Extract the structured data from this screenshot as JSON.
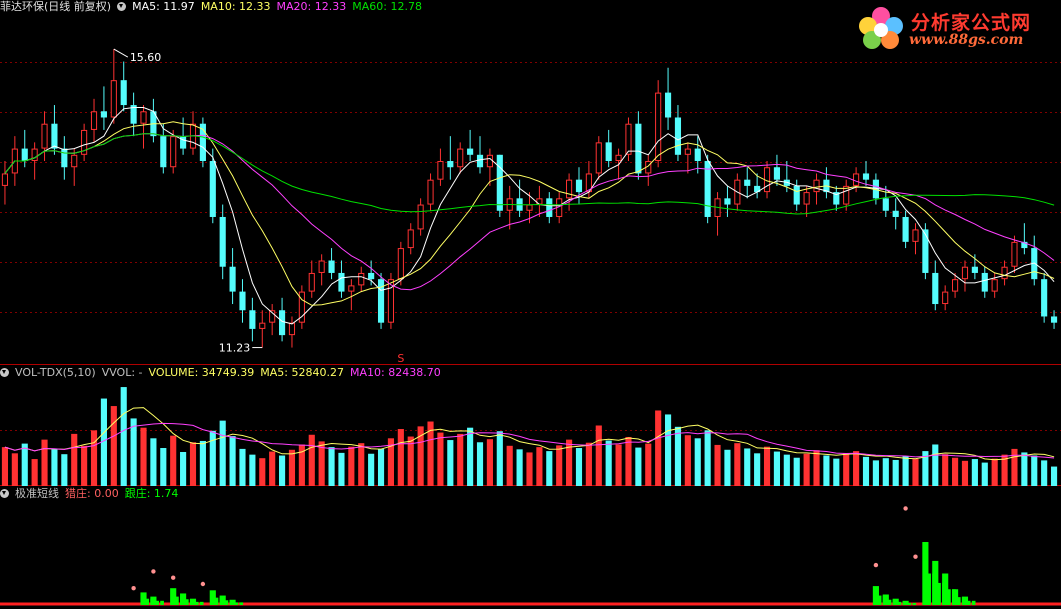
{
  "price_header": {
    "title": "菲达环保(日线 前复权)",
    "ma5": "MA5: 11.97",
    "ma10": "MA10: 12.33",
    "ma20": "MA20: 12.33",
    "ma60": "MA60: 12.78"
  },
  "vol_header": {
    "title": "VOL-TDX(5,10)",
    "vvol": "VVOL: -",
    "volume": "VOLUME: 34749.39",
    "ma5": "MA5: 52840.27",
    "ma10": "MA10: 82438.70"
  },
  "ind_header": {
    "title": "极准短线",
    "lie": "猎庄: 0.00",
    "gen": "跟庄: 1.74"
  },
  "logo": {
    "title": "分析家公式网",
    "url": "www.88gs.com"
  },
  "marker": "S",
  "colors": {
    "up": "#ff3232",
    "down": "#54fcfc",
    "ma5": "#ffffff",
    "ma10": "#ffff64",
    "ma20": "#ff40ff",
    "ma60": "#00e000",
    "grid": "#800000",
    "green_bar": "#00ff00",
    "red_band": "#ff2020",
    "dot": "#ff9090"
  },
  "chart_data": {
    "type": "candlestick",
    "high_label": "15.60",
    "low_label": "11.23",
    "price_ylim": [
      10.6,
      16.1
    ],
    "candles": [
      [
        13.4,
        13.8,
        13.1,
        13.6
      ],
      [
        13.6,
        14.2,
        13.4,
        14.0
      ],
      [
        14.0,
        14.3,
        13.7,
        13.8
      ],
      [
        13.8,
        14.1,
        13.5,
        14.0
      ],
      [
        14.0,
        14.6,
        13.8,
        14.4
      ],
      [
        14.4,
        14.7,
        13.9,
        14.0
      ],
      [
        14.0,
        14.2,
        13.5,
        13.7
      ],
      [
        13.7,
        14.0,
        13.4,
        13.9
      ],
      [
        13.9,
        14.4,
        13.8,
        14.3
      ],
      [
        14.3,
        14.8,
        14.1,
        14.6
      ],
      [
        14.6,
        15.0,
        14.3,
        14.5
      ],
      [
        14.5,
        15.6,
        14.4,
        15.1
      ],
      [
        15.1,
        15.4,
        14.6,
        14.7
      ],
      [
        14.7,
        14.9,
        14.2,
        14.4
      ],
      [
        14.4,
        14.7,
        14.0,
        14.6
      ],
      [
        14.6,
        14.8,
        14.1,
        14.2
      ],
      [
        14.2,
        14.4,
        13.6,
        13.7
      ],
      [
        13.7,
        14.3,
        13.6,
        14.2
      ],
      [
        14.2,
        14.5,
        13.9,
        14.0
      ],
      [
        14.0,
        14.6,
        13.9,
        14.4
      ],
      [
        14.4,
        14.5,
        13.7,
        13.8
      ],
      [
        13.8,
        14.0,
        12.8,
        12.9
      ],
      [
        12.9,
        13.1,
        11.9,
        12.1
      ],
      [
        12.1,
        12.4,
        11.5,
        11.7
      ],
      [
        11.7,
        11.9,
        11.2,
        11.4
      ],
      [
        11.4,
        11.6,
        10.9,
        11.1
      ],
      [
        11.1,
        11.4,
        10.8,
        11.2
      ],
      [
        11.2,
        11.5,
        11.0,
        11.4
      ],
      [
        11.4,
        11.6,
        10.9,
        11.0
      ],
      [
        11.0,
        11.3,
        10.8,
        11.2
      ],
      [
        11.2,
        11.8,
        11.1,
        11.7
      ],
      [
        11.7,
        12.2,
        11.6,
        12.0
      ],
      [
        12.0,
        12.3,
        11.8,
        12.2
      ],
      [
        12.2,
        12.4,
        11.9,
        12.0
      ],
      [
        12.0,
        12.2,
        11.6,
        11.7
      ],
      [
        11.7,
        11.9,
        11.4,
        11.8
      ],
      [
        11.8,
        12.1,
        11.7,
        12.0
      ],
      [
        12.0,
        12.2,
        11.8,
        11.9
      ],
      [
        11.9,
        12.0,
        11.1,
        11.2
      ],
      [
        11.2,
        12.0,
        11.1,
        11.9
      ],
      [
        11.9,
        12.5,
        11.8,
        12.4
      ],
      [
        12.4,
        12.8,
        12.3,
        12.7
      ],
      [
        12.7,
        13.2,
        12.6,
        13.1
      ],
      [
        13.1,
        13.6,
        13.0,
        13.5
      ],
      [
        13.5,
        14.0,
        13.4,
        13.8
      ],
      [
        13.8,
        14.2,
        13.5,
        13.7
      ],
      [
        13.7,
        14.1,
        13.6,
        14.0
      ],
      [
        14.0,
        14.3,
        13.8,
        13.9
      ],
      [
        13.9,
        14.2,
        13.6,
        13.7
      ],
      [
        13.7,
        14.0,
        13.4,
        13.9
      ],
      [
        13.9,
        13.9,
        12.9,
        13.0
      ],
      [
        13.0,
        13.4,
        12.7,
        13.2
      ],
      [
        13.2,
        13.5,
        12.9,
        13.0
      ],
      [
        13.0,
        13.3,
        12.8,
        13.1
      ],
      [
        13.1,
        13.4,
        12.9,
        13.2
      ],
      [
        13.2,
        13.3,
        12.8,
        12.9
      ],
      [
        12.9,
        13.3,
        12.8,
        13.2
      ],
      [
        13.2,
        13.6,
        13.0,
        13.5
      ],
      [
        13.5,
        13.7,
        13.1,
        13.3
      ],
      [
        13.3,
        13.8,
        13.2,
        13.6
      ],
      [
        13.6,
        14.2,
        13.5,
        14.1
      ],
      [
        14.1,
        14.3,
        13.7,
        13.8
      ],
      [
        13.8,
        14.0,
        13.5,
        13.9
      ],
      [
        13.9,
        14.5,
        13.8,
        14.4
      ],
      [
        14.4,
        14.6,
        13.5,
        13.6
      ],
      [
        13.6,
        13.9,
        13.4,
        13.8
      ],
      [
        13.8,
        15.1,
        13.7,
        14.9
      ],
      [
        14.9,
        15.3,
        14.3,
        14.5
      ],
      [
        14.5,
        14.7,
        13.8,
        13.9
      ],
      [
        13.9,
        14.1,
        13.6,
        14.0
      ],
      [
        14.0,
        14.2,
        13.6,
        13.8
      ],
      [
        13.8,
        13.9,
        12.8,
        12.9
      ],
      [
        12.9,
        13.3,
        12.6,
        13.2
      ],
      [
        13.2,
        13.4,
        12.9,
        13.1
      ],
      [
        13.1,
        13.6,
        13.0,
        13.5
      ],
      [
        13.5,
        13.7,
        13.2,
        13.4
      ],
      [
        13.4,
        13.6,
        13.2,
        13.3
      ],
      [
        13.3,
        13.8,
        13.2,
        13.7
      ],
      [
        13.7,
        13.9,
        13.4,
        13.5
      ],
      [
        13.5,
        13.8,
        13.3,
        13.4
      ],
      [
        13.4,
        13.5,
        13.0,
        13.1
      ],
      [
        13.1,
        13.4,
        12.9,
        13.3
      ],
      [
        13.3,
        13.6,
        13.1,
        13.5
      ],
      [
        13.5,
        13.7,
        13.2,
        13.3
      ],
      [
        13.3,
        13.4,
        13.0,
        13.1
      ],
      [
        13.1,
        13.5,
        13.0,
        13.4
      ],
      [
        13.4,
        13.7,
        13.3,
        13.6
      ],
      [
        13.6,
        13.8,
        13.4,
        13.5
      ],
      [
        13.5,
        13.6,
        13.1,
        13.2
      ],
      [
        13.2,
        13.4,
        12.9,
        13.0
      ],
      [
        13.0,
        13.2,
        12.7,
        12.9
      ],
      [
        12.9,
        13.0,
        12.4,
        12.5
      ],
      [
        12.5,
        12.8,
        12.3,
        12.7
      ],
      [
        12.7,
        12.8,
        11.9,
        12.0
      ],
      [
        12.0,
        12.2,
        11.4,
        11.5
      ],
      [
        11.5,
        11.8,
        11.4,
        11.7
      ],
      [
        11.7,
        12.0,
        11.6,
        11.9
      ],
      [
        11.9,
        12.2,
        11.7,
        12.1
      ],
      [
        12.1,
        12.3,
        11.9,
        12.0
      ],
      [
        12.0,
        12.1,
        11.6,
        11.7
      ],
      [
        11.7,
        12.0,
        11.6,
        11.9
      ],
      [
        11.9,
        12.2,
        11.8,
        12.1
      ],
      [
        12.1,
        12.6,
        12.0,
        12.5
      ],
      [
        12.5,
        12.8,
        12.3,
        12.4
      ],
      [
        12.4,
        12.6,
        11.8,
        11.9
      ],
      [
        11.9,
        12.0,
        11.2,
        11.3
      ],
      [
        11.3,
        11.4,
        11.1,
        11.2
      ]
    ],
    "volumes": [
      8.8,
      7.4,
      9.6,
      6.1,
      10.5,
      8.3,
      7.2,
      11.8,
      9.1,
      12.6,
      19.8,
      18.1,
      22.4,
      15.3,
      13.2,
      10.8,
      8.6,
      11.4,
      7.7,
      9.9,
      10.2,
      12.5,
      14.8,
      11.3,
      8.4,
      7.1,
      6.3,
      7.8,
      6.9,
      8.2,
      9.4,
      11.6,
      10.1,
      8.8,
      7.5,
      8.9,
      9.7,
      7.3,
      8.4,
      10.8,
      12.9,
      11.2,
      13.5,
      14.6,
      12.1,
      10.4,
      11.8,
      13.2,
      9.9,
      10.6,
      12.4,
      9.1,
      8.3,
      7.6,
      8.8,
      7.9,
      9.2,
      10.5,
      8.6,
      9.8,
      13.7,
      10.3,
      9.4,
      11.1,
      8.7,
      9.6,
      17.1,
      16.2,
      13.4,
      11.5,
      10.8,
      12.6,
      9.3,
      8.2,
      9.7,
      8.5,
      7.4,
      8.9,
      7.8,
      7.1,
      6.4,
      7.3,
      8.1,
      6.9,
      6.2,
      7.4,
      7.9,
      6.6,
      5.8,
      6.3,
      5.9,
      6.8,
      6.1,
      7.9,
      9.4,
      7.2,
      6.4,
      5.7,
      6.1,
      5.3,
      6.2,
      7.1,
      8.4,
      7.6,
      6.9,
      5.8,
      4.4
    ],
    "volume_ylim": [
      0,
      24
    ],
    "lie_zhuang_ylim": [
      0,
      10
    ],
    "gen_zhuang": [
      0,
      0,
      0,
      0,
      0,
      0,
      0,
      0,
      0,
      0,
      0,
      0,
      0,
      0,
      0,
      0,
      0,
      0,
      0,
      0,
      0,
      0,
      0,
      0,
      0,
      0,
      0,
      0,
      0,
      0,
      0,
      0,
      0,
      0,
      0,
      0,
      0,
      0,
      0,
      0,
      0,
      0,
      0,
      0,
      0,
      0,
      0,
      0,
      0,
      0,
      0,
      0,
      0,
      0,
      0,
      0,
      0,
      0,
      0,
      0,
      0,
      0,
      0,
      0,
      0,
      0,
      0,
      0,
      0,
      0,
      0,
      0,
      0,
      0,
      0,
      0,
      0,
      0,
      0,
      0,
      0,
      0,
      0,
      0,
      0,
      0,
      0,
      0,
      0,
      0,
      0,
      0,
      0,
      0,
      0,
      0,
      0,
      0,
      0,
      0,
      0,
      0,
      0,
      0,
      0,
      0,
      0,
      1.74
    ],
    "gen_zhuang_bars": {
      "14": 1.2,
      "15": 0.8,
      "17": 1.6,
      "18": 1.1,
      "19": 0.6,
      "21": 1.4,
      "22": 0.9,
      "23": 0.5,
      "88": 1.8,
      "89": 1.0,
      "90": 0.6,
      "91": 0.4,
      "93": 6.0,
      "94": 4.2,
      "95": 3.0,
      "96": 1.5,
      "97": 0.8
    },
    "dots": {
      "13": 1.6,
      "15": 3.2,
      "17": 2.6,
      "20": 2.0,
      "88": 3.8,
      "91": 9.2,
      "92": 4.6
    },
    "marker_index": 40
  }
}
